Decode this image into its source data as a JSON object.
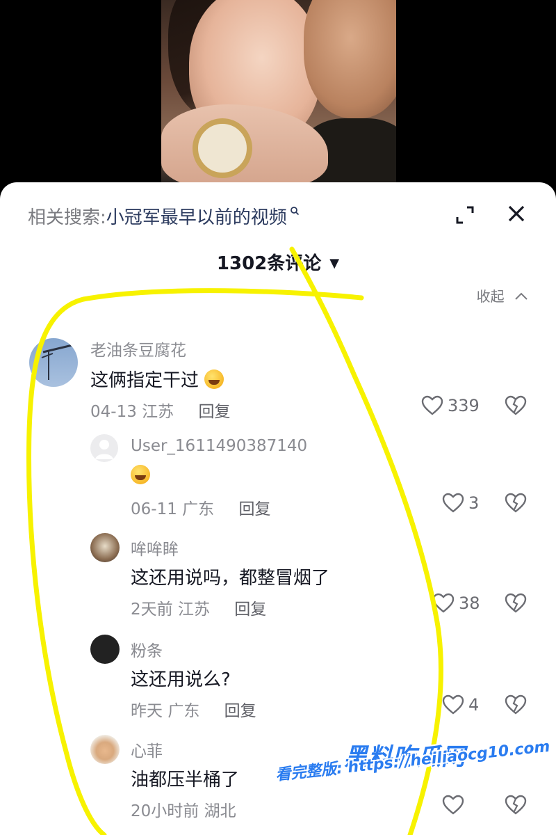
{
  "search": {
    "label": "相关搜索:",
    "query": "小冠军最早以前的视频"
  },
  "comments_header": {
    "count_label": "1302条评论",
    "collapse_label": "收起"
  },
  "comments": [
    {
      "user": "老油条豆腐花",
      "text": "这俩指定干过",
      "date": "04-13",
      "region": "江苏",
      "reply": "回复",
      "likes": "339"
    },
    {
      "user": "User_1611490387140",
      "text": "",
      "date": "06-11",
      "region": "广东",
      "reply": "回复",
      "likes": "3"
    },
    {
      "user": "哞哞眸",
      "text": "这还用说吗，都整冒烟了",
      "date": "2天前",
      "region": "江苏",
      "reply": "回复",
      "likes": "38"
    },
    {
      "user": "粉条",
      "text": "这还用说么?",
      "date": "昨天",
      "region": "广东",
      "reply": "回复",
      "likes": "4"
    },
    {
      "user": "心菲",
      "text": "油都压半桶了",
      "date": "20小时前",
      "region": "湖北",
      "reply": "回复",
      "likes": ""
    }
  ],
  "watermark": {
    "title": "黑料吃瓜网",
    "url": "看完整版: https://heiliaocg10.com"
  },
  "colors": {
    "annotation": "#f7f200",
    "watermark": "#2a7cf0"
  },
  "icons": {
    "expand": "expand-icon",
    "close": "close-icon",
    "like": "heart-icon",
    "dislike": "broken-heart-icon",
    "search": "search-icon"
  }
}
